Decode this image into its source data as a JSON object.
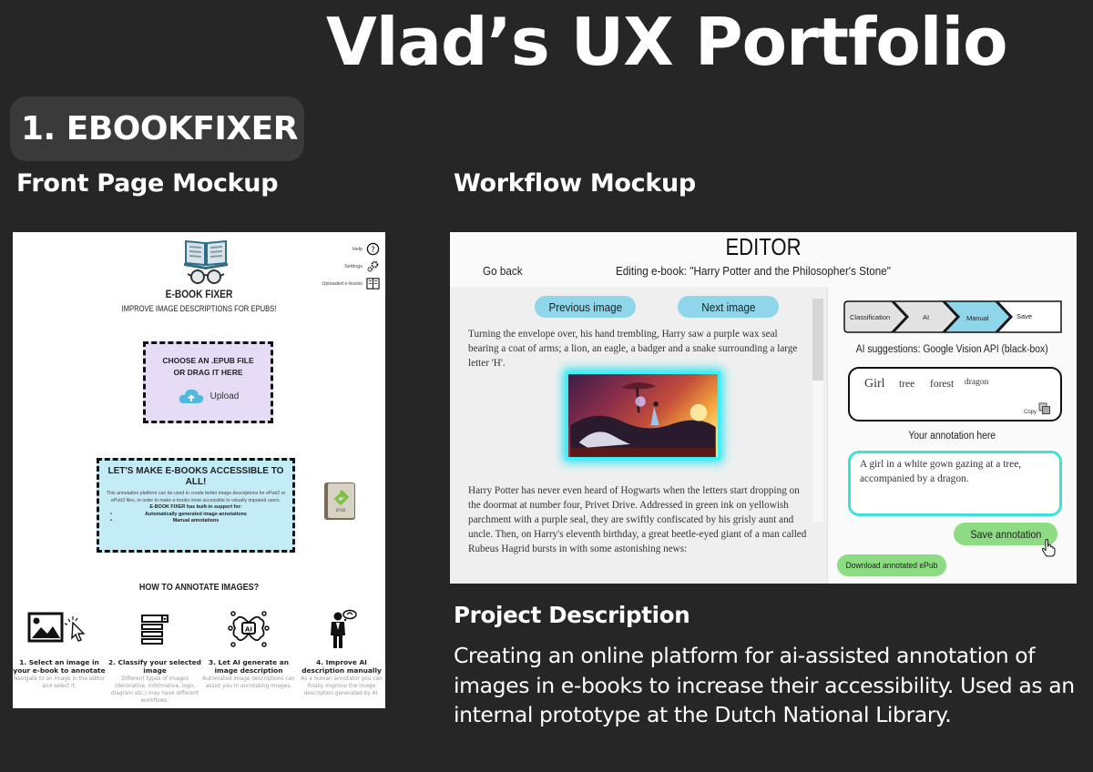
{
  "page": {
    "title": "Vlad’s UX Portfolio",
    "section_badge": "1. EBOOKFIXER",
    "front_heading": "Front Page Mockup",
    "workflow_heading": "Workflow Mockup"
  },
  "front_page": {
    "brand": "E-BOOK FIXER",
    "tagline": "IMPROVE IMAGE DESCRIPTIONS FOR EPUBS!",
    "nav": [
      {
        "label": "Help",
        "icon": "help-circle-icon"
      },
      {
        "label": "Settings",
        "icon": "gears-icon"
      },
      {
        "label": "Uploaded e-books",
        "icon": "open-book-icon"
      }
    ],
    "upload": {
      "title_line1": "CHOOSE AN .EPUB  FILE",
      "title_line2": "OR DRAG IT HERE",
      "button_label": "Upload",
      "icon": "cloud-upload-icon"
    },
    "accessibility": {
      "title": "LET'S MAKE E-BOOKS ACCESSIBLE TO ALL!",
      "body": "This annotation platform can be used to create better image descriptions for ePub2 or ePub3 files, in order to make e-books more accessible to visually impaired users.",
      "support_heading": "E-BOOK FIXER has built-in support for:",
      "features": [
        "Automatically generated image annotations",
        "Manual annotations"
      ],
      "epub_icon_label": "EPUB"
    },
    "howto": {
      "title": "HOW TO ANNOTATE IMAGES?",
      "steps": [
        {
          "title": "1.  Select an image in your e-book to annotate",
          "desc": "Navigate to an image in the editor and select it.",
          "icon": "image-select-icon"
        },
        {
          "title": "2. Classify your selected image",
          "desc": "Different types of images (decorative, informative, logo, diagram etc.) may have different workflows.",
          "icon": "dropdown-list-icon"
        },
        {
          "title": "3.  Let AI generate an image description",
          "desc": "Automated image descriptions can assist you in annotating images.",
          "icon": "ai-chip-icon"
        },
        {
          "title": "4. Improve AI description manually",
          "desc": "As a human annotator you can finally improve the image description generated by AI.",
          "icon": "thinking-person-icon"
        }
      ]
    }
  },
  "workflow": {
    "title": "EDITOR",
    "go_back": "Go back",
    "editing_label": "Editing e-book: \"Harry Potter and the Philosopher's Stone\"",
    "prev_image": "Previous image",
    "next_image": "Next image",
    "paragraph1": "Turning the envelope over, his hand trembling, Harry saw a purple wax seal bearing a coat of arms; a lion, an eagle, a badger and a snake surrounding a large letter 'H'.",
    "paragraph2": "Harry Potter has never even heard of Hogwarts when the letters start dropping on the doormat at number four, Privet Drive. Addressed in green ink on yellowish parchment with a purple seal, they are swiftly confiscated by his grisly aunt and uncle. Then, on Harry's eleventh birthday, a great beetle-eyed giant of a man called Rubeus Hagrid bursts in with some astonishing news:",
    "steps": [
      {
        "label": "Classification",
        "state": "done"
      },
      {
        "label": "AI",
        "state": "done"
      },
      {
        "label": "Manual",
        "state": "active"
      },
      {
        "label": "Save",
        "state": "pending"
      }
    ],
    "ai_suggestions_label": "AI suggestions: Google Vision API (black-box)",
    "ai_tags": [
      "Girl",
      "tree",
      "forest",
      "dragon"
    ],
    "copy_label": "Copy",
    "annotation_label": "Your annotation here",
    "annotation_value": "A girl in a white gown gazing at a tree, accompanied by a dragon.",
    "save_annotation": "Save annotation",
    "download_epub": "Download annotated ePub",
    "colors": {
      "nav_pill": "#8fd6ea",
      "step_active": "#8fd6ea",
      "step_done": "#e2e2e2",
      "green_button": "#8ddc84",
      "input_border": "#3fe0d6"
    }
  },
  "project": {
    "heading": "Project Description",
    "description": "Creating an online platform for ai-assisted annotation of images in e-books to increase their accessibility. Used as an internal prototype at the Dutch National Library."
  }
}
